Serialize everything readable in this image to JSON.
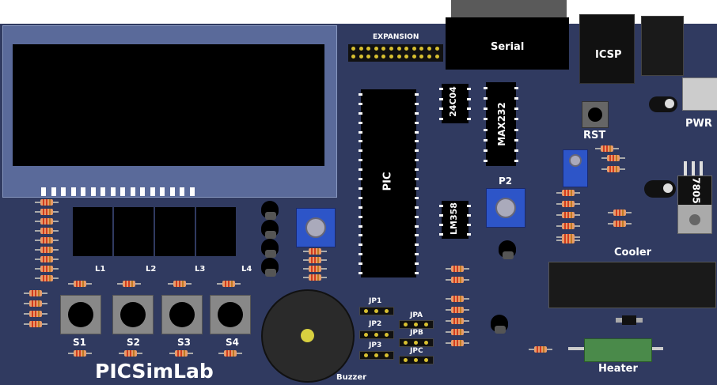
{
  "board": {
    "title": "PICSimLab",
    "labels": {
      "expansion": "EXPANSION",
      "serial": "Serial",
      "icsp": "ICSP",
      "pwr": "PWR",
      "rst": "RST",
      "pic": "PIC",
      "eeprom": "24C04",
      "max232": "MAX232",
      "lm358": "LM358",
      "p2": "P2",
      "cooler": "Cooler",
      "heater": "Heater",
      "buzzer": "Buzzer",
      "reg": "7805"
    },
    "leds": [
      "L1",
      "L2",
      "L3",
      "L4"
    ],
    "switches": [
      "S1",
      "S2",
      "S3",
      "S4"
    ],
    "jumpers": [
      "JP1",
      "JP2",
      "JP3",
      "JPA",
      "JPB",
      "JPC"
    ]
  },
  "colors": {
    "board": "#303a60",
    "lcd_frame": "#5a6a9a",
    "lcd_screen": "#000000",
    "buzzer": "#2a2a2a",
    "heater": "#4a8a4a"
  }
}
